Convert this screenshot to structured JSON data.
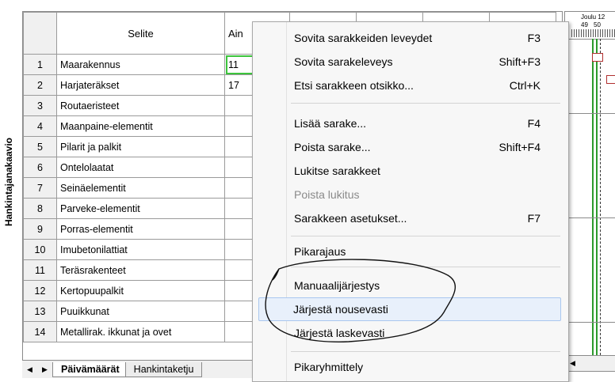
{
  "side_label": "Hankintajanakaavio",
  "grid": {
    "headers": [
      "",
      "Selite",
      "Ain"
    ],
    "rows": [
      {
        "num": "1",
        "desc": "Maarakennus",
        "ain": "11"
      },
      {
        "num": "2",
        "desc": "Harjateräkset",
        "ain": "17"
      },
      {
        "num": "3",
        "desc": "Routaeristeet",
        "ain": ""
      },
      {
        "num": "4",
        "desc": "Maanpaine-elementit",
        "ain": ""
      },
      {
        "num": "5",
        "desc": "Pilarit ja palkit",
        "ain": ""
      },
      {
        "num": "6",
        "desc": "Ontelolaatat",
        "ain": ""
      },
      {
        "num": "7",
        "desc": "Seinäelementit",
        "ain": ""
      },
      {
        "num": "8",
        "desc": "Parveke-elementit",
        "ain": ""
      },
      {
        "num": "9",
        "desc": "Porras-elementit",
        "ain": ""
      },
      {
        "num": "10",
        "desc": "Imubetonilattiat",
        "ain": ""
      },
      {
        "num": "11",
        "desc": "Teräsrakenteet",
        "ain": ""
      },
      {
        "num": "12",
        "desc": "Kertopuupalkit",
        "ain": ""
      },
      {
        "num": "13",
        "desc": "Puuikkunat",
        "ain": ""
      },
      {
        "num": "14",
        "desc": "Metallirak. ikkunat ja ovet",
        "ain": ""
      }
    ]
  },
  "tabs": {
    "prev": "◀",
    "next": "▶",
    "active": "Päivämäärät",
    "inactive": "Hankintaketju"
  },
  "gantt": {
    "month": "Joulu 12",
    "week1": "49",
    "week2": "50",
    "scroll_left": "◀"
  },
  "menu": {
    "items": [
      {
        "label": "Sovita sarakkeiden leveydet",
        "shortcut": "F3"
      },
      {
        "label": "Sovita sarakeleveys",
        "shortcut": "Shift+F3"
      },
      {
        "label": "Etsi sarakkeen otsikko...",
        "shortcut": "Ctrl+K"
      },
      {
        "label": "Lisää sarake...",
        "shortcut": "F4"
      },
      {
        "label": "Poista sarake...",
        "shortcut": "Shift+F4"
      },
      {
        "label": "Lukitse sarakkeet",
        "shortcut": ""
      },
      {
        "label": "Poista lukitus",
        "shortcut": ""
      },
      {
        "label": "Sarakkeen asetukset...",
        "shortcut": "F7"
      },
      {
        "label": "Pikarajaus",
        "shortcut": ""
      },
      {
        "label": "Manuaalijärjestys",
        "shortcut": ""
      },
      {
        "label": "Järjestä nousevasti",
        "shortcut": ""
      },
      {
        "label": "Järjestä laskevasti",
        "shortcut": ""
      },
      {
        "label": "Pikaryhmittely",
        "shortcut": ""
      }
    ]
  },
  "colors": {
    "selection": "#3cc43c",
    "highlight": "#e8f0fb",
    "gantt_line": "#2c9a2c",
    "gantt_bar": "#b03030"
  }
}
